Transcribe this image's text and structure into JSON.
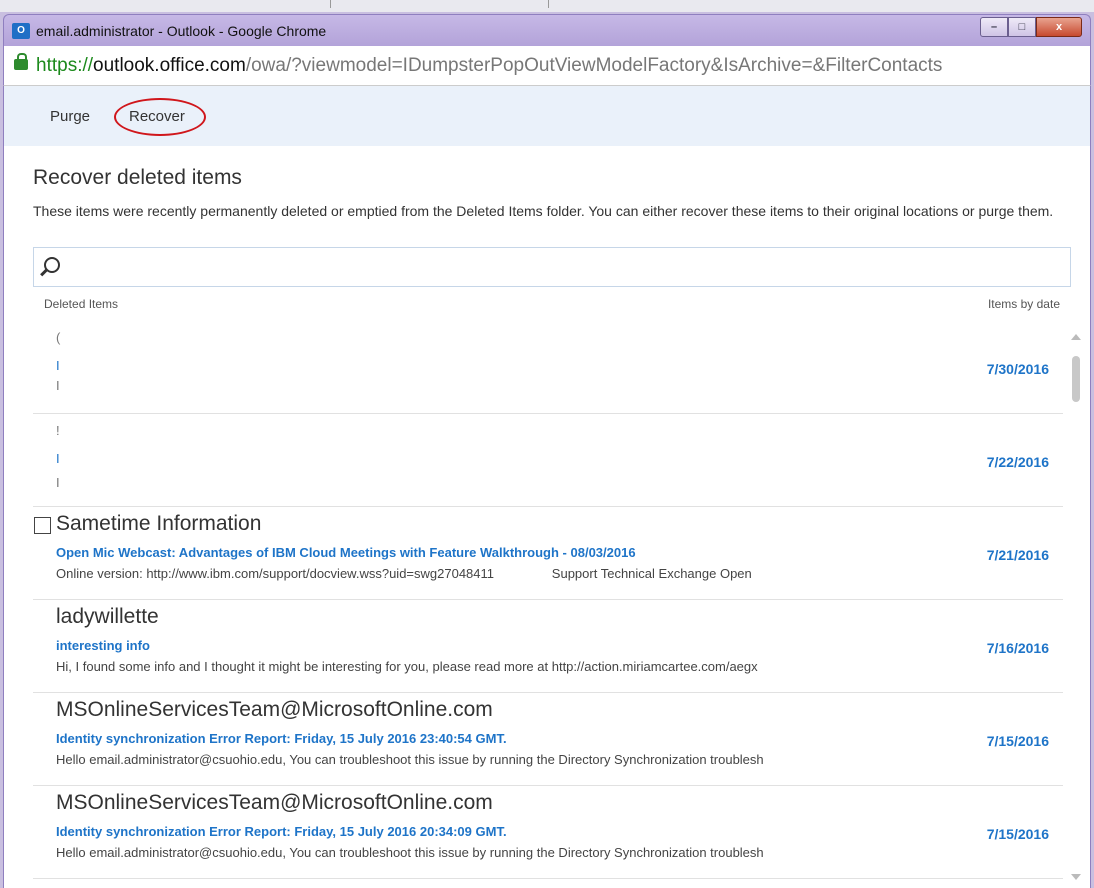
{
  "window": {
    "title": "email.administrator - Outlook - Google Chrome",
    "icon_label": "O",
    "controls": {
      "minimize": "–",
      "maximize": "□",
      "close": "x"
    }
  },
  "address": {
    "scheme": "https://",
    "host": "outlook.office.com",
    "path": "/owa/?viewmodel=IDumpsterPopOutViewModelFactory&IsArchive=&FilterContacts"
  },
  "toolbar": {
    "purge_label": "Purge",
    "recover_label": "Recover"
  },
  "page": {
    "heading": "Recover deleted items",
    "description": "These items were recently permanently deleted or emptied from the Deleted Items folder. You can either recover these items to their original locations or purge them."
  },
  "list_header": {
    "left": "Deleted Items",
    "right": "Items by date"
  },
  "items": [
    {
      "sender": "",
      "subject": "",
      "preview": "",
      "date": "7/30/2016",
      "fragments": [
        "(",
        "I",
        "I"
      ]
    },
    {
      "sender": "",
      "subject": "",
      "preview": "",
      "date": "7/22/2016",
      "fragments": [
        "!",
        "I",
        "I"
      ]
    },
    {
      "sender": "Sametime Information",
      "subject": "Open Mic Webcast: Advantages of IBM Cloud Meetings with Feature Walkthrough - 08/03/2016",
      "preview": "Online version: http://www.ibm.com/support/docview.wss?uid=swg27048411                Support Technical Exchange Open",
      "date": "7/21/2016"
    },
    {
      "sender": "ladywillette",
      "subject": "interesting info",
      "preview": "Hi, I found some info and I thought it might be interesting for you, please read more at http://action.miriamcartee.com/aegx",
      "date": "7/16/2016"
    },
    {
      "sender": "MSOnlineServicesTeam@MicrosoftOnline.com",
      "subject": "Identity synchronization Error Report: Friday, 15 July 2016 23:40:54 GMT.",
      "preview": "Hello email.administrator@csuohio.edu,  You can troubleshoot this issue by running the Directory Synchronization troublesh",
      "date": "7/15/2016"
    },
    {
      "sender": "MSOnlineServicesTeam@MicrosoftOnline.com",
      "subject": "Identity synchronization Error Report: Friday, 15 July 2016 20:34:09 GMT.",
      "preview": "Hello email.administrator@csuohio.edu,  You can troubleshoot this issue by running the Directory Synchronization troublesh",
      "date": "7/15/2016"
    }
  ]
}
